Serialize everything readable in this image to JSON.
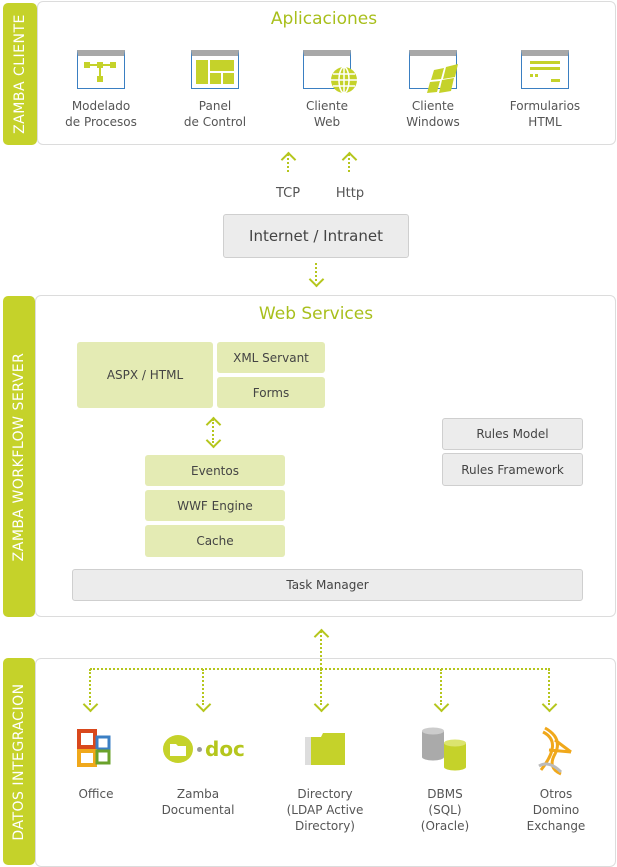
{
  "client": {
    "label": "ZAMBA CLIENTE",
    "title": "Aplicaciones",
    "apps": [
      {
        "icon": "process-model-icon",
        "line1": "Modelado",
        "line2": "de Procesos"
      },
      {
        "icon": "dashboard-icon",
        "line1": "Panel",
        "line2": "de Control"
      },
      {
        "icon": "web-globe-icon",
        "line1": "Cliente",
        "line2": "Web"
      },
      {
        "icon": "windows-icon",
        "line1": "Cliente",
        "line2": "Windows"
      },
      {
        "icon": "form-icon",
        "line1": "Formularios",
        "line2": "HTML"
      }
    ]
  },
  "protocols": [
    "TCP",
    "Http"
  ],
  "network": "Internet / Intranet",
  "server": {
    "label": "ZAMBA WORKFLOW SERVER",
    "title": "Web Services",
    "aspx": "ASPX / HTML",
    "xml": "XML Servant",
    "forms": "Forms",
    "eventos": "Eventos",
    "wwf": "WWF Engine",
    "cache": "Cache",
    "rules_model": "Rules Model",
    "rules_framework": "Rules Framework",
    "task_manager": "Task Manager"
  },
  "data": {
    "label": "DATOS INTEGRACION",
    "doc_logo": "doc",
    "items": [
      {
        "icon": "office-icon",
        "lines": [
          "Office"
        ]
      },
      {
        "icon": "zamba-doc-icon",
        "lines": [
          "Zamba",
          "Documental"
        ]
      },
      {
        "icon": "folder-icon",
        "lines": [
          "Directory",
          "(LDAP Active",
          "Directory)"
        ]
      },
      {
        "icon": "database-icon",
        "lines": [
          "DBMS",
          "(SQL)",
          "(Oracle)"
        ]
      },
      {
        "icon": "sharepoint-icon",
        "lines": [
          "Otros",
          "Domino",
          "Exchange"
        ]
      }
    ]
  },
  "colors": {
    "accent": "#c5d22a",
    "light": "#e4ebb4",
    "gray": "#ececec"
  }
}
